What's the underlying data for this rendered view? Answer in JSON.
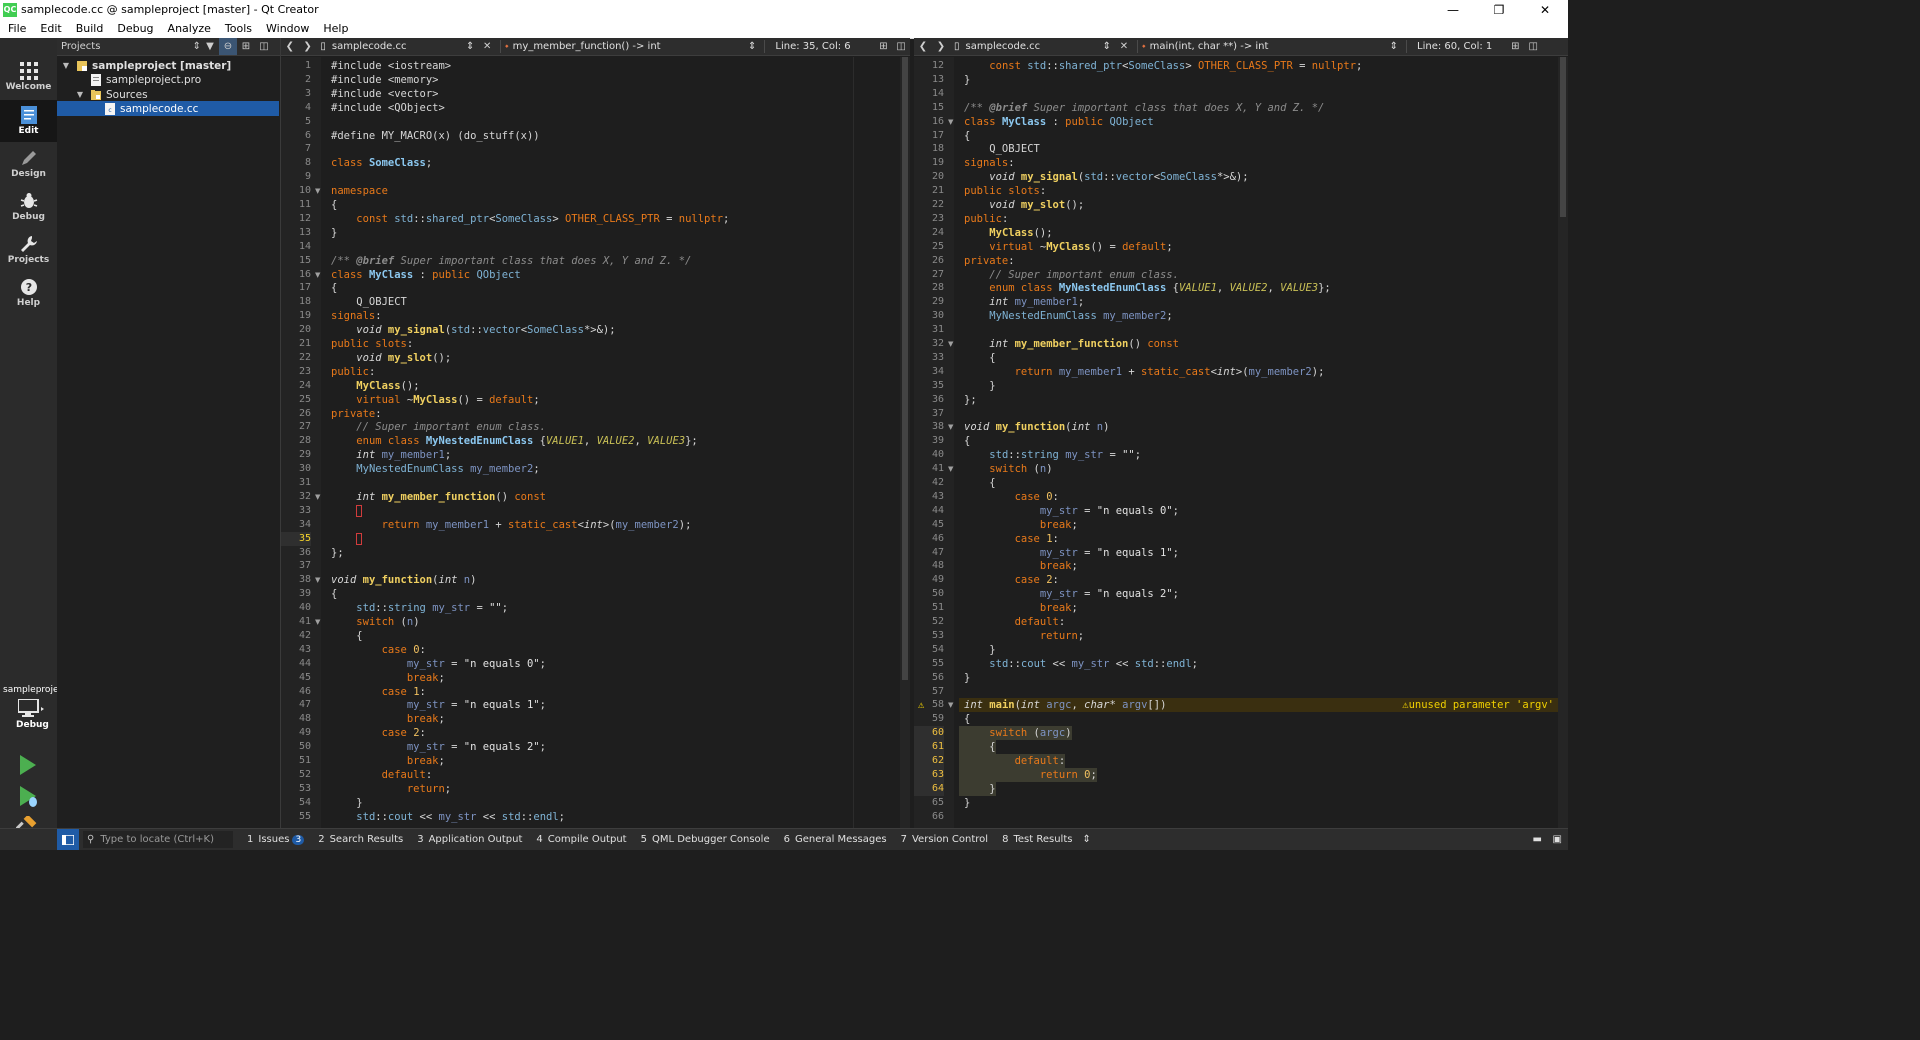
{
  "window": {
    "title": "samplecode.cc @ sampleproject [master] - Qt Creator",
    "app_icon_text": "QC",
    "minimize": "—",
    "restore": "❐",
    "close": "✕"
  },
  "menu": [
    "File",
    "Edit",
    "Build",
    "Debug",
    "Analyze",
    "Tools",
    "Window",
    "Help"
  ],
  "modes": [
    {
      "label": "Welcome",
      "icon": "grid-icon"
    },
    {
      "label": "Edit",
      "icon": "document-icon",
      "active": true
    },
    {
      "label": "Design",
      "icon": "pencil-icon"
    },
    {
      "label": "Debug",
      "icon": "bug-icon"
    },
    {
      "label": "Projects",
      "icon": "wrench-icon"
    },
    {
      "label": "Help",
      "icon": "help-icon"
    }
  ],
  "kit": {
    "project": "sampleproject",
    "label": "Debug"
  },
  "projects_pane": {
    "selector": "Projects",
    "tree": [
      {
        "label": "sampleproject [master]",
        "level": 0,
        "expanded": true,
        "bold": true,
        "icon": "project-folder-icon"
      },
      {
        "label": "sampleproject.pro",
        "level": 1,
        "icon": "pro-file-icon"
      },
      {
        "label": "Sources",
        "level": 1,
        "expanded": true,
        "icon": "folder-icon"
      },
      {
        "label": "samplecode.cc",
        "level": 2,
        "icon": "cpp-file-icon",
        "selected": true
      }
    ]
  },
  "left_editor": {
    "document": "samplecode.cc",
    "function": "my_member_function() -> int",
    "position": "Line: 35, Col: 6",
    "current_line": 35,
    "first_line": 1
  },
  "right_editor": {
    "document": "samplecode.cc",
    "function": "main(int, char **) -> int",
    "position": "Line: 60, Col: 1",
    "first_line": 12,
    "warning_line": 58,
    "warning_text": "unused parameter 'argv'",
    "selected_lines": [
      60,
      61,
      62,
      63,
      64
    ]
  },
  "code": [
    "#include <iostream>",
    "#include <memory>",
    "#include <vector>",
    "#include <QObject>",
    "",
    "#define MY_MACRO(x) (do_stuff(x))",
    "",
    "class SomeClass;",
    "",
    "namespace",
    "{",
    "    const std::shared_ptr<SomeClass> OTHER_CLASS_PTR = nullptr;",
    "}",
    "",
    "/** @brief Super important class that does X, Y and Z. */",
    "class MyClass : public QObject",
    "{",
    "    Q_OBJECT",
    "signals:",
    "    void my_signal(std::vector<SomeClass*>&);",
    "public slots:",
    "    void my_slot();",
    "public:",
    "    MyClass();",
    "    virtual ~MyClass() = default;",
    "private:",
    "    // Super important enum class.",
    "    enum class MyNestedEnumClass {VALUE1, VALUE2, VALUE3};",
    "    int my_member1;",
    "    MyNestedEnumClass my_member2;",
    "",
    "    int my_member_function() const",
    "    {",
    "        return my_member1 + static_cast<int>(my_member2);",
    "    }",
    "};",
    "",
    "void my_function(int n)",
    "{",
    "    std::string my_str = \"\";",
    "    switch (n)",
    "    {",
    "        case 0:",
    "            my_str = \"n equals 0\";",
    "            break;",
    "        case 1:",
    "            my_str = \"n equals 1\";",
    "            break;",
    "        case 2:",
    "            my_str = \"n equals 2\";",
    "            break;",
    "        default:",
    "            return;",
    "    }",
    "    std::cout << my_str << std::endl;",
    "}",
    "",
    "int main(int argc, char* argv[])",
    "{",
    "    switch (argc)",
    "    {",
    "        default:",
    "            return 0;",
    "    }",
    "}",
    ""
  ],
  "fold_lines": [
    10,
    16,
    32,
    38,
    41,
    58
  ],
  "statusbar": {
    "locator_placeholder": "Type to locate (Ctrl+K)",
    "panes": [
      {
        "num": "1",
        "label": "Issues",
        "badge": "3"
      },
      {
        "num": "2",
        "label": "Search Results"
      },
      {
        "num": "3",
        "label": "Application Output"
      },
      {
        "num": "4",
        "label": "Compile Output"
      },
      {
        "num": "5",
        "label": "QML Debugger Console"
      },
      {
        "num": "6",
        "label": "General Messages"
      },
      {
        "num": "7",
        "label": "Version Control"
      },
      {
        "num": "8",
        "label": "Test Results"
      }
    ]
  },
  "colors": {
    "keyword": "#e8791a",
    "function": "#f0d060",
    "class": "#8cc8f0",
    "comment": "#8c8c8c",
    "selection": "#1f5ba6",
    "warning": "#f0d000"
  }
}
